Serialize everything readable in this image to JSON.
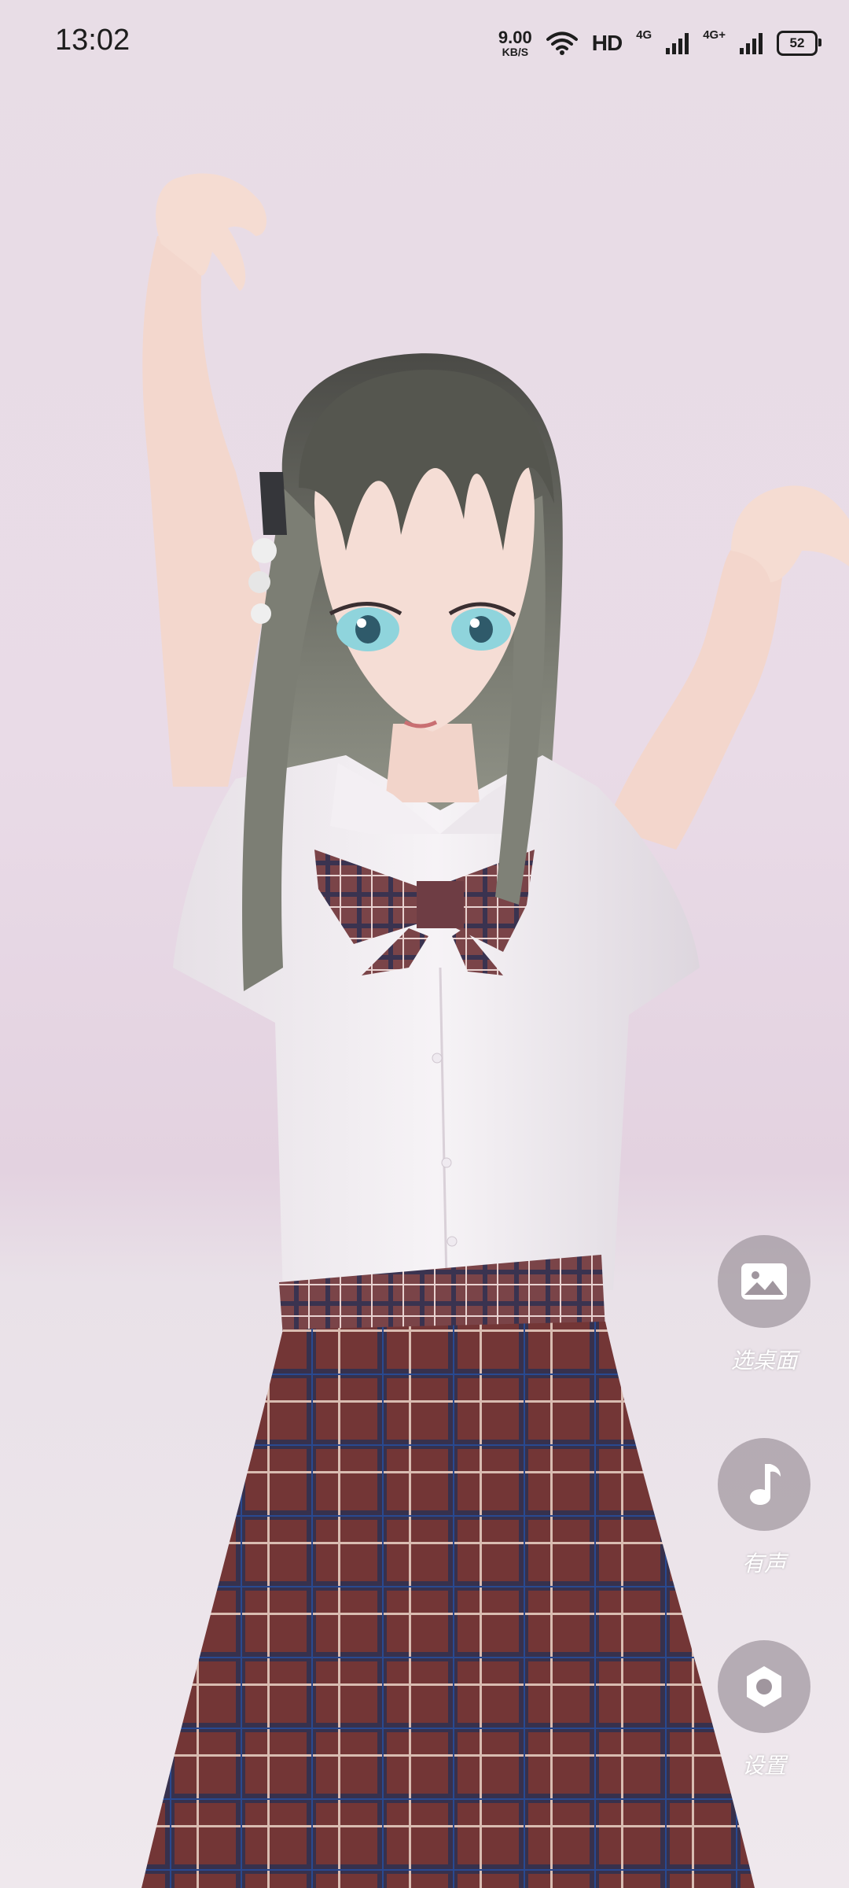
{
  "status_bar": {
    "time": "13:02",
    "net_speed_value": "9.00",
    "net_speed_unit": "KB/S",
    "hd_label": "HD",
    "sim1_label": "4G",
    "sim2_label": "4G+",
    "battery": "52",
    "icons": [
      "wifi-icon",
      "signal-icon",
      "battery-icon"
    ]
  },
  "controls": [
    {
      "label": "选桌面",
      "icon": "image-icon"
    },
    {
      "label": "有声",
      "icon": "music-note-icon"
    },
    {
      "label": "设置",
      "icon": "settings-icon"
    }
  ],
  "colors": {
    "control_bg": "#a0969e",
    "skirt": "#7a3b3a",
    "hair": "#6f7167"
  }
}
